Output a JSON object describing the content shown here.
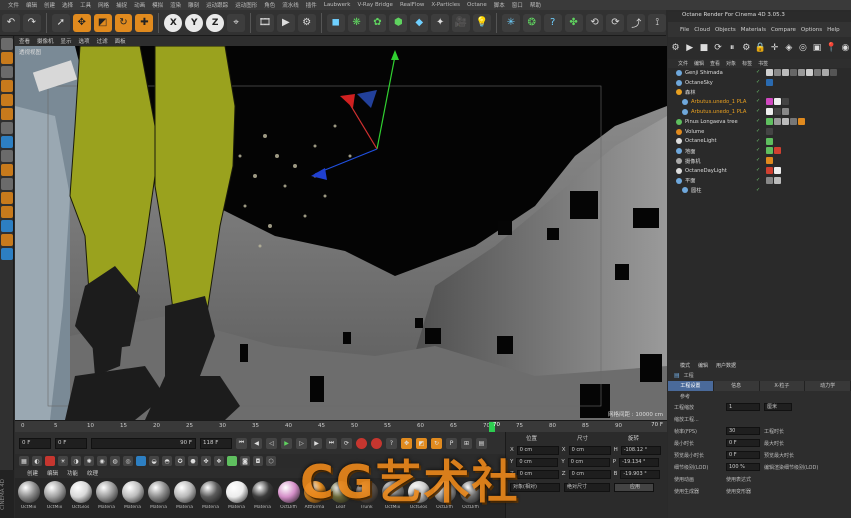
{
  "menu": [
    "文件",
    "编辑",
    "创建",
    "选择",
    "工具",
    "网格",
    "捕捉",
    "动画",
    "模拟",
    "渲染",
    "雕刻",
    "运动跟踪",
    "运动图形",
    "角色",
    "流水线",
    "插件",
    "Laubwerk",
    "V-Ray Bridge",
    "RealFlow",
    "X-Particles",
    "Octane",
    "脚本",
    "窗口",
    "帮助"
  ],
  "toolbar": {
    "axis_x": "X",
    "axis_y": "Y",
    "axis_z": "Z"
  },
  "viewport": {
    "menu": [
      "查看",
      "摄像机",
      "显示",
      "选项",
      "过滤",
      "面板"
    ],
    "label": "透视视图",
    "grid_info": "网格间距 : 10000 cm"
  },
  "timeline": {
    "ticks": [
      "0",
      "5",
      "10",
      "15",
      "20",
      "25",
      "30",
      "35",
      "40",
      "45",
      "50",
      "55",
      "60",
      "65",
      "70",
      "75",
      "80",
      "85",
      "90"
    ],
    "current_frame": "70",
    "end_label": "70 F",
    "start_field": "0 F",
    "start_field2": "0 F",
    "end_field": "90 F",
    "end_field2": "118 F"
  },
  "materials": {
    "menu": [
      "创建",
      "编辑",
      "功能",
      "纹理"
    ],
    "items": [
      {
        "label": "OctMix",
        "color": "#8a8a8a"
      },
      {
        "label": "OctMix",
        "color": "#a0a0a0"
      },
      {
        "label": "OctGlos",
        "color": "#d8d8d8"
      },
      {
        "label": "Materia",
        "color": "#9a9a9a"
      },
      {
        "label": "Materia",
        "color": "#bcbcbc"
      },
      {
        "label": "Materia",
        "color": "#8c8c8c"
      },
      {
        "label": "Materia",
        "color": "#b8b8b8"
      },
      {
        "label": "Materia",
        "color": "#5a5a5a"
      },
      {
        "label": "Materia",
        "color": "#ececec"
      },
      {
        "label": "Materia",
        "color": "#3a3a3a"
      },
      {
        "label": "OctDiffi",
        "color": "#d48ec8"
      },
      {
        "label": "Attforma",
        "color": "#e08a1e"
      },
      {
        "label": "Leaf",
        "color": "#6a6a3a"
      },
      {
        "label": "Trunk",
        "color": "#5a5048"
      },
      {
        "label": "OctMix",
        "color": "#7a7a7a"
      },
      {
        "label": "OctGlos",
        "color": "#cccccc"
      },
      {
        "label": "OctDiffi",
        "color": "#9a9a9a"
      },
      {
        "label": "OctDiffi",
        "color": "#707070"
      }
    ]
  },
  "coords": {
    "headers": [
      "位置",
      "尺寸",
      "旋转"
    ],
    "rows": [
      {
        "axis": "X",
        "pos": "0 cm",
        "size": "0 cm",
        "rot_axis": "H",
        "rot": "-108.12 °"
      },
      {
        "axis": "Y",
        "pos": "0 cm",
        "size": "0 cm",
        "rot_axis": "P",
        "rot": "-19.134 °"
      },
      {
        "axis": "Z",
        "pos": "0 cm",
        "size": "0 cm",
        "rot_axis": "B",
        "rot": "-19.903 °"
      }
    ],
    "mode1": "对象(相对)",
    "mode2": "绝对尺寸",
    "apply": "应用"
  },
  "rpanel": {
    "title": "Octane Render For Cinema 4D 3.05.3",
    "menu": [
      "File",
      "Cloud",
      "Objects",
      "Materials",
      "Compare",
      "Options",
      "Help"
    ],
    "om_menu": [
      "文件",
      "编辑",
      "查看",
      "对象",
      "标签",
      "书签"
    ],
    "objects": [
      {
        "name": "Genji Shimada",
        "indent": 0,
        "icon": "#6fa8dc",
        "sel": false,
        "tags": [
          "#d0d0d0",
          "#888",
          "#bbb",
          "#666",
          "#999",
          "#ccc",
          "#777",
          "#aaa",
          "#555"
        ]
      },
      {
        "name": "OctaneSky",
        "indent": 0,
        "icon": "#6fa8dc",
        "sel": false,
        "tags": [
          "#2a6ab0"
        ]
      },
      {
        "name": "森林",
        "indent": 0,
        "icon": "#e8a020",
        "sel": false,
        "tags": []
      },
      {
        "name": "Arbutus.unedo_1 PLA",
        "indent": 1,
        "icon": "#6fa8dc",
        "sel": true,
        "tags": [
          "#d048c0",
          "#eee",
          "#444"
        ]
      },
      {
        "name": "Arbutus.unedo_1 PLA",
        "indent": 1,
        "icon": "#6fa8dc",
        "sel": true,
        "tags": [
          "#eee",
          "#444",
          "#888"
        ]
      },
      {
        "name": "Pinus Longaeva tree",
        "indent": 0,
        "icon": "#5fbf5f",
        "sel": false,
        "tags": [
          "#5fbf5f",
          "#999",
          "#bbb",
          "#777",
          "#e08a1e"
        ]
      },
      {
        "name": "Volume",
        "indent": 0,
        "icon": "#e08a1e",
        "sel": false,
        "tags": [
          "#444"
        ]
      },
      {
        "name": "OctaneLight",
        "indent": 0,
        "icon": "#dddddd",
        "sel": false,
        "tags": [
          "#5fbf5f"
        ]
      },
      {
        "name": "地面",
        "indent": 0,
        "icon": "#6fa8dc",
        "sel": false,
        "tags": [
          "#5fbf5f",
          "#d04030"
        ]
      },
      {
        "name": "摄像机",
        "indent": 0,
        "icon": "#aaaaaa",
        "sel": false,
        "tags": [
          "#e08a1e"
        ]
      },
      {
        "name": "OctaneDayLight",
        "indent": 0,
        "icon": "#dddddd",
        "sel": false,
        "tags": [
          "#d04030",
          "#eee"
        ]
      },
      {
        "name": "平面",
        "indent": 0,
        "icon": "#6fa8dc",
        "sel": false,
        "tags": [
          "#888",
          "#bbb"
        ]
      },
      {
        "name": "圆柱",
        "indent": 1,
        "icon": "#6fa8dc",
        "sel": false,
        "tags": []
      }
    ],
    "attr_menu": [
      "模式",
      "编辑",
      "用户数据"
    ],
    "attr_title": "工程",
    "attr_tabs": [
      "工程设置",
      "信息",
      "X-粒子",
      "动力学"
    ],
    "subtab": "参考",
    "rows": [
      {
        "label": "工程缩放",
        "value": "1",
        "unit": "厘米"
      },
      {
        "label": "缩放工程...",
        "value": "",
        "unit": ""
      },
      {
        "label": "帧率(FPS)",
        "value": "30",
        "right": "工程时长"
      },
      {
        "label": "最小时长",
        "value": "0 F",
        "right": "最大时长"
      },
      {
        "label": "预览最小时长",
        "value": "0 F",
        "right": "预览最大时长"
      },
      {
        "label": "细节级别(LOD)",
        "value": "100 %",
        "right": "编辑渲染细节级别(LOD)"
      },
      {
        "label": "使用动画",
        "value": "",
        "right": "使用表达式"
      },
      {
        "label": "使用生成器",
        "value": "",
        "right": "使用变形器"
      }
    ]
  },
  "watermark": "CG艺术社"
}
